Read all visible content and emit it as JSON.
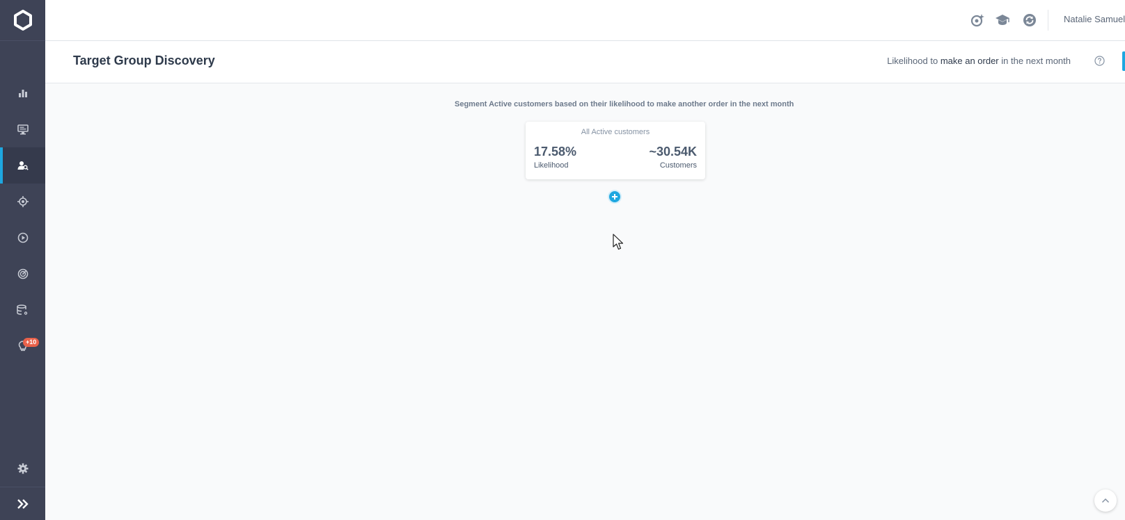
{
  "app": {
    "page_title": "Target Group Discovery",
    "user_name": "Natalie Samuels"
  },
  "header": {
    "likelihood_prefix": "Likelihood to",
    "likelihood_action": "make an order",
    "likelihood_suffix": "in the next month"
  },
  "sidebar": {
    "items": [
      {
        "icon": "bar-chart-icon"
      },
      {
        "icon": "monitor-icon"
      },
      {
        "icon": "user-search-icon",
        "active": true
      },
      {
        "icon": "target-icon"
      },
      {
        "icon": "play-icon"
      },
      {
        "icon": "radar-icon"
      },
      {
        "icon": "database-settings-icon"
      },
      {
        "icon": "lightbulb-icon",
        "badge": "+10"
      }
    ],
    "settings_icon": "gear-icon",
    "collapse_icon": "chevron-double-right-icon"
  },
  "segment": {
    "description": "Segment Active customers based on their likelihood to make another order in the next month",
    "card": {
      "title": "All Active customers",
      "likelihood_value": "17.58%",
      "likelihood_label": "Likelihood",
      "customers_value": "~30.54K",
      "customers_label": "Customers"
    }
  },
  "colors": {
    "sidebar_bg": "#3e4356",
    "accent": "#1ea7e0",
    "badge": "#e8614a"
  }
}
